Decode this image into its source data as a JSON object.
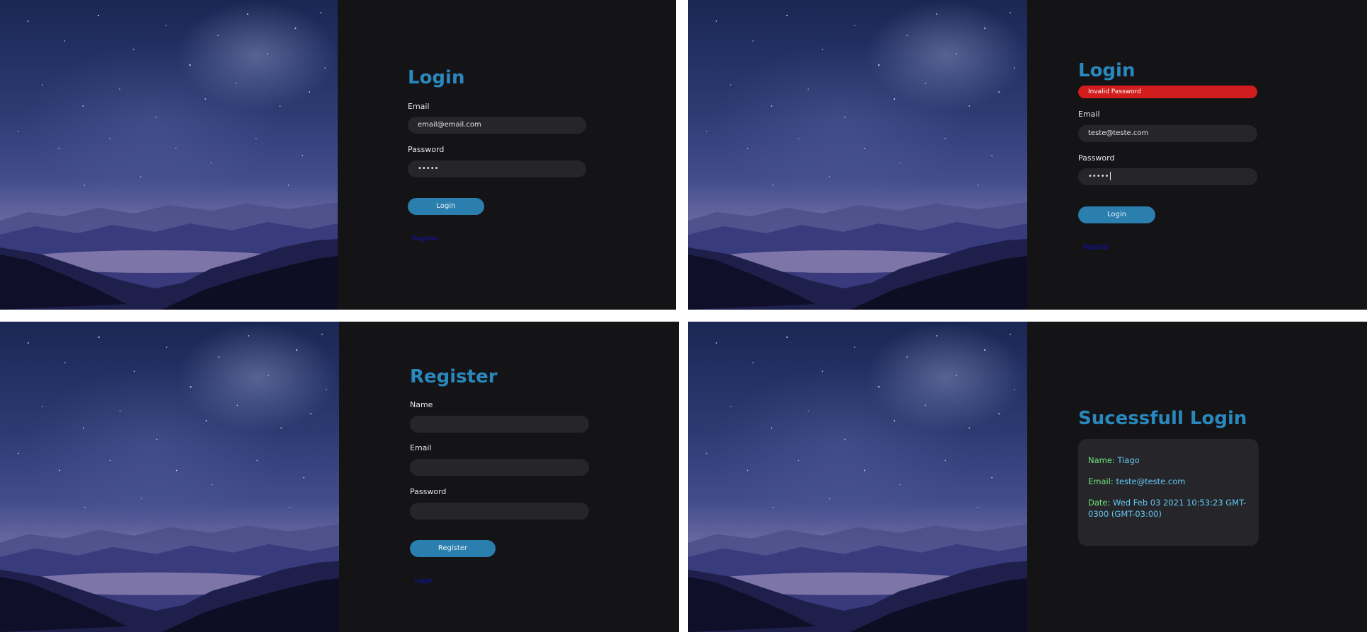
{
  "screens": {
    "login": {
      "title": "Login",
      "email_label": "Email",
      "email_value": "email@email.com",
      "password_label": "Password",
      "password_value": "•••••",
      "button_label": "Login",
      "link_label": "Register"
    },
    "login_error": {
      "title": "Login",
      "error_message": "Invalid Password",
      "email_label": "Email",
      "email_value": "teste@teste.com",
      "password_label": "Password",
      "password_value": "•••••",
      "button_label": "Login",
      "link_label": "Register"
    },
    "register": {
      "title": "Register",
      "name_label": "Name",
      "name_value": "",
      "email_label": "Email",
      "email_value": "",
      "password_label": "Password",
      "password_value": "",
      "button_label": "Register",
      "link_label": "Login"
    },
    "success": {
      "title": "Sucessfull Login",
      "name_key": "Name:",
      "name_value": "Tiago",
      "email_key": "Email:",
      "email_value": "teste@teste.com",
      "date_key": "Date:",
      "date_value": "Wed Feb 03 2021 10:53:23 GMT-0300 (GMT-03:00)"
    }
  },
  "colors": {
    "background": "#141417",
    "title": "#2a88bd",
    "input": "#26262a",
    "button": "#2a7fae",
    "error": "#d11d1d",
    "link": "#1010c8",
    "card_key": "#6de57a",
    "card_value": "#63c7f2"
  }
}
